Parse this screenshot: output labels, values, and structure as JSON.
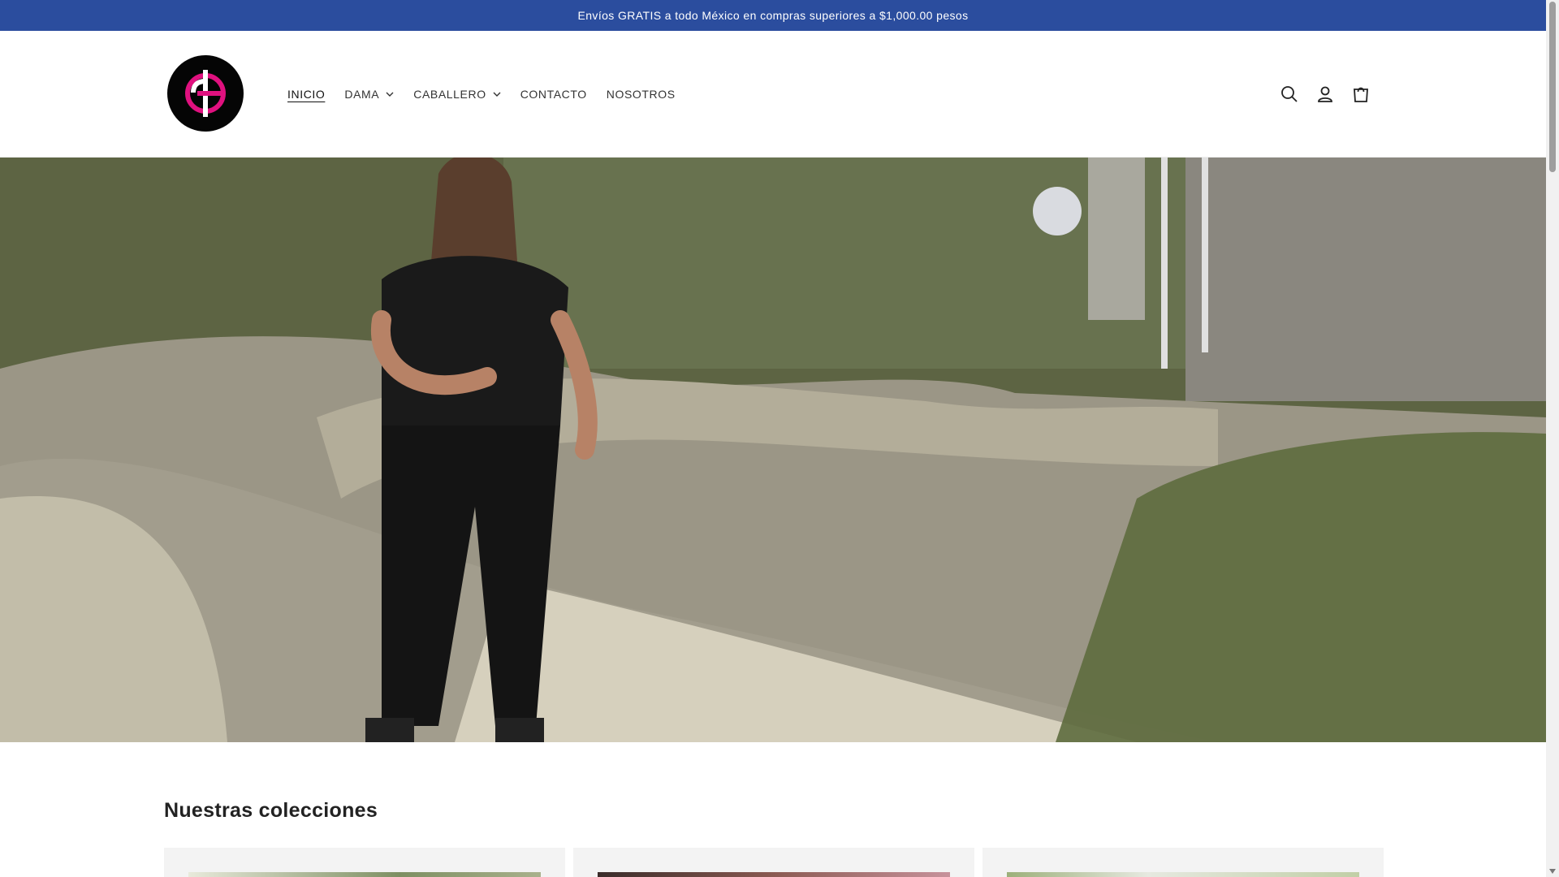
{
  "announcement": {
    "text": "Envíos GRATIS a todo México en compras superiores a $1,000.00 pesos"
  },
  "header": {
    "nav": [
      {
        "label": "INICIO",
        "active": true,
        "has_dropdown": false
      },
      {
        "label": "DAMA",
        "active": false,
        "has_dropdown": true
      },
      {
        "label": "CABALLERO",
        "active": false,
        "has_dropdown": true
      },
      {
        "label": "CONTACTO",
        "active": false,
        "has_dropdown": false
      },
      {
        "label": "NOSOTROS",
        "active": false,
        "has_dropdown": false
      }
    ],
    "icons": [
      "search-icon",
      "account-icon",
      "cart-icon"
    ]
  },
  "colors": {
    "announcement_bg": "#2b4d9e",
    "logo_bg": "#050505",
    "logo_accent": "#e0117f"
  },
  "collections": {
    "title": "Nuestras colecciones"
  }
}
